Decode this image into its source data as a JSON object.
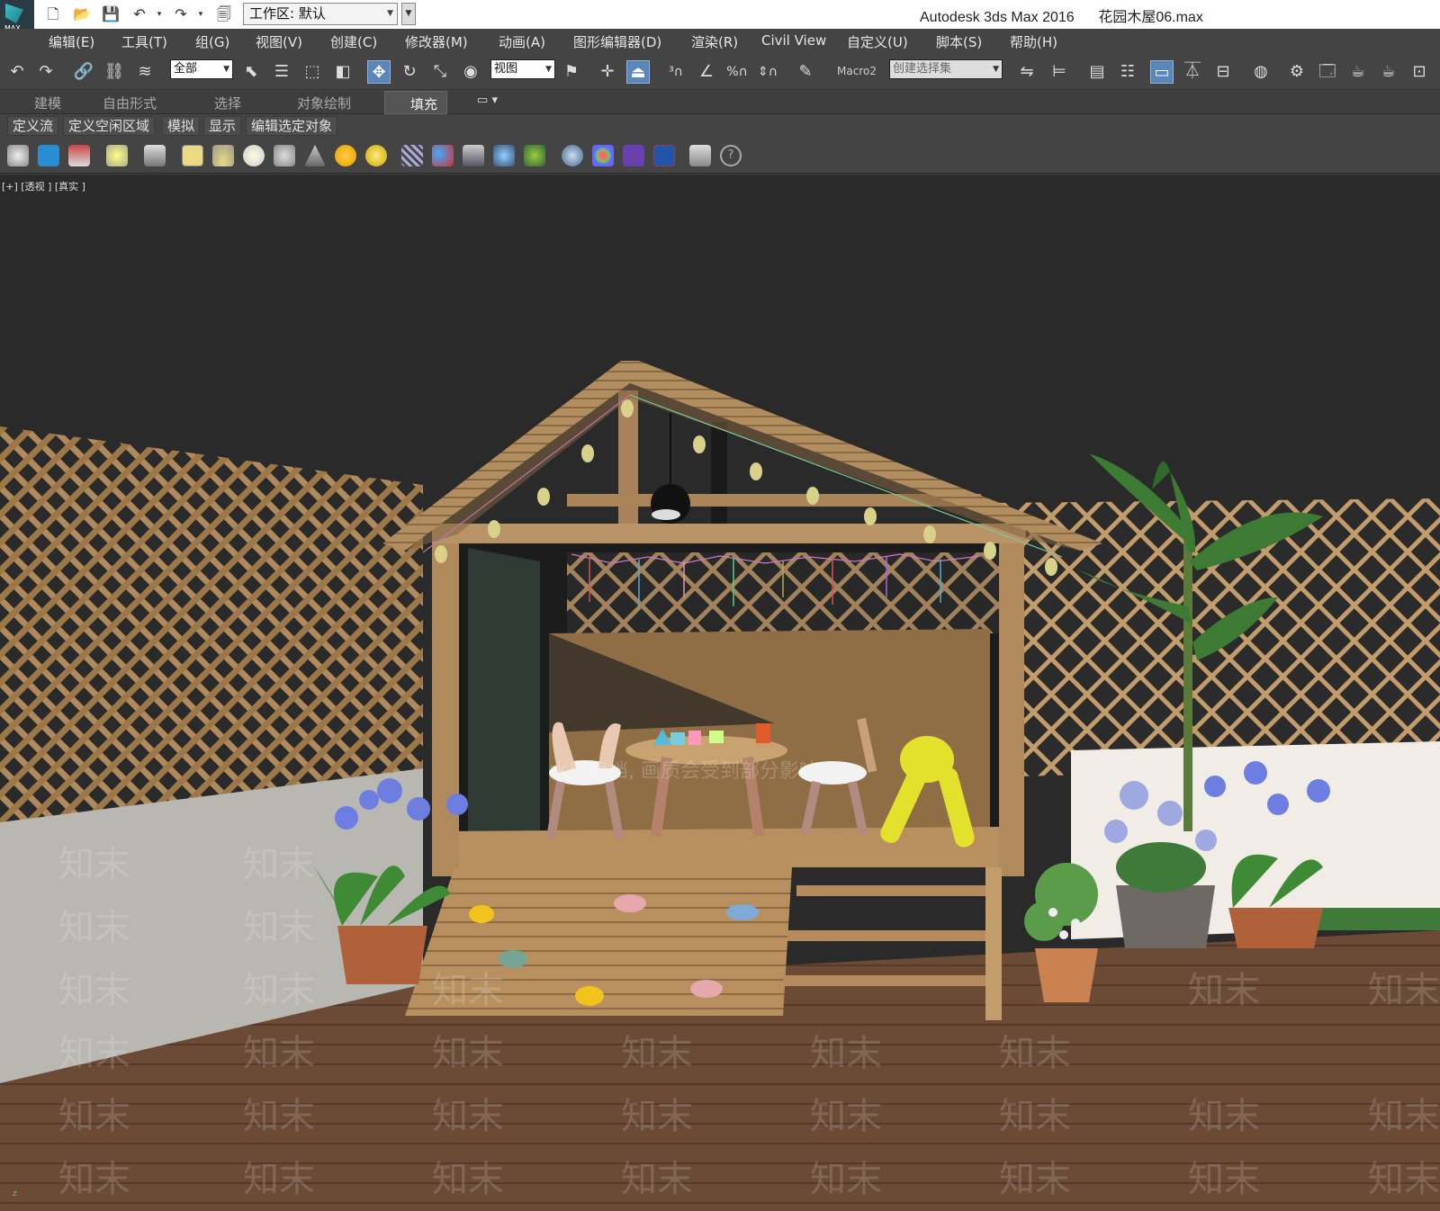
{
  "titlebar": {
    "logo_text": "MAX",
    "workspace": "工作区: 默认",
    "app_name": "Autodesk 3ds Max 2016",
    "file_name": "花园木屋06.max"
  },
  "menu": {
    "items": [
      "编辑(E)",
      "工具(T)",
      "组(G)",
      "视图(V)",
      "创建(C)",
      "修改器(M)",
      "动画(A)",
      "图形编辑器(D)",
      "渲染(R)",
      "Civil View",
      "自定义(U)",
      "脚本(S)",
      "帮助(H)"
    ]
  },
  "toolbar": {
    "selection_filter": "全部",
    "reference_coord": "视图",
    "macro_label": "Macro2",
    "named_selection_placeholder": "创建选择集"
  },
  "ribbon": {
    "tabs": [
      "建模",
      "自由形式",
      "选择",
      "对象绘制"
    ],
    "active_tab": "填充",
    "options_glyph": "▾",
    "panels": [
      "定义流",
      "定义空闲区域",
      "模拟",
      "显示",
      "编辑选定对象"
    ]
  },
  "viewport": {
    "label": "[+] [透视 ] [真实 ]",
    "watermark": "知末",
    "overlay_text": "水印遮挡, 画质会受到部分影响",
    "axis_z": "z"
  },
  "colors": {
    "titlebar_bg": "#ffffff",
    "ui_bg": "#444444",
    "viewport_bg": "#2a2a2a",
    "active_tool": "#5a86b8",
    "wood": "#b08a5c",
    "deck": "#6b4a36"
  }
}
